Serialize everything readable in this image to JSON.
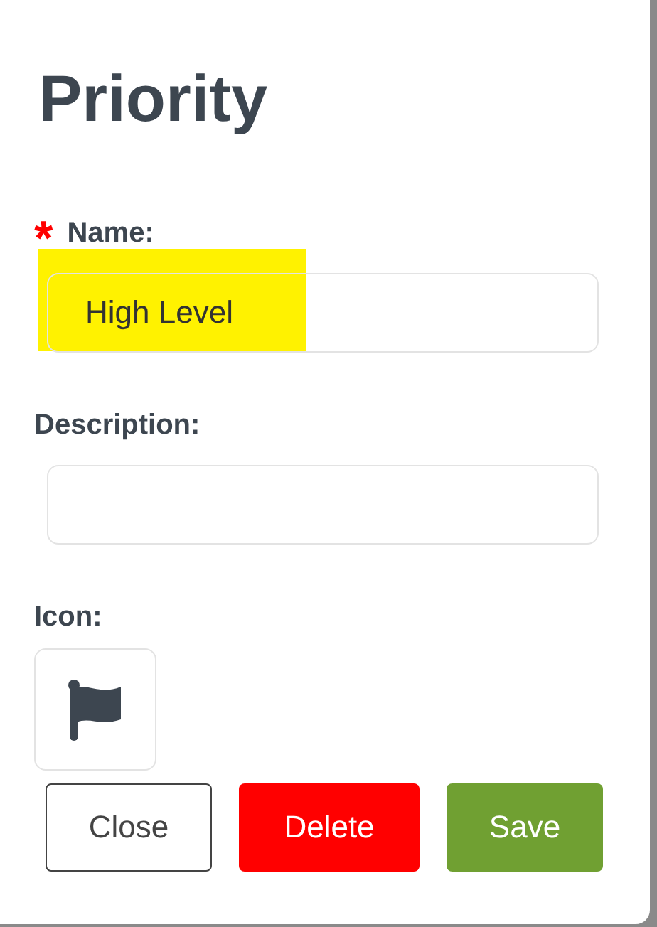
{
  "title": "Priority",
  "fields": [
    {
      "label": "Name:",
      "required": true,
      "required_mark": "*",
      "value": "High Level",
      "highlighted": true
    },
    {
      "label": "Description:",
      "required": false,
      "highlighted": false
    }
  ],
  "icon_field": {
    "label": "Icon:"
  },
  "buttons": [
    {
      "label": "Close",
      "kind": "outline"
    },
    {
      "label": "Delete",
      "kind": "danger"
    },
    {
      "label": "Save",
      "kind": "primary"
    }
  ]
}
